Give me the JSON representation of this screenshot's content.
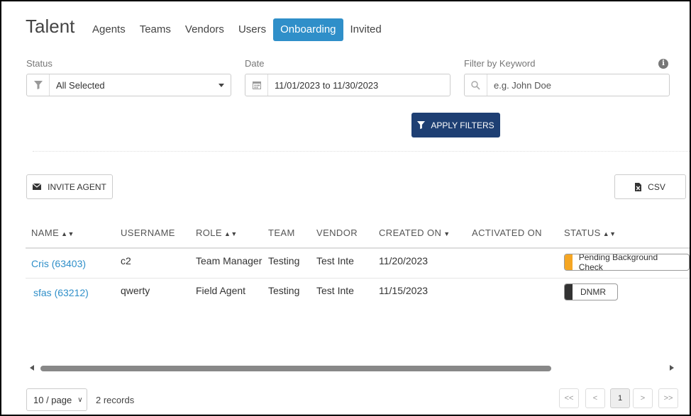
{
  "header": {
    "title": "Talent",
    "tabs": [
      {
        "label": "Agents"
      },
      {
        "label": "Teams"
      },
      {
        "label": "Vendors"
      },
      {
        "label": "Users"
      },
      {
        "label": "Onboarding",
        "active": true
      },
      {
        "label": "Invited"
      }
    ]
  },
  "filters": {
    "status": {
      "label": "Status",
      "value": "All Selected",
      "icon": "filter-icon"
    },
    "date": {
      "label": "Date",
      "value": "11/01/2023 to 11/30/2023",
      "icon": "calendar-icon"
    },
    "keyword": {
      "label": "Filter by Keyword",
      "placeholder": "e.g. John Doe",
      "icon": "search-icon"
    },
    "apply_label": "APPLY FILTERS"
  },
  "actions": {
    "invite_label": "INVITE AGENT",
    "csv_label": "CSV"
  },
  "table": {
    "columns": [
      "NAME",
      "USERNAME",
      "ROLE",
      "TEAM",
      "VENDOR",
      "CREATED ON",
      "ACTIVATED ON",
      "STATUS"
    ],
    "rows": [
      {
        "name": "Cris (63403)",
        "username": "c2",
        "role": "Team Manager",
        "team": "Testing",
        "vendor": "Test Inte",
        "created_on": "11/20/2023",
        "activated_on": "",
        "status": "Pending Background Check",
        "status_color": "#f5a623"
      },
      {
        "name": "sfas (63212)",
        "username": "qwerty",
        "role": "Field Agent",
        "team": "Testing",
        "vendor": "Test Inte",
        "created_on": "11/15/2023",
        "activated_on": "",
        "status": "DNMR",
        "status_color": "#333333"
      }
    ]
  },
  "footer": {
    "page_size": "10 / page",
    "records": "2 records",
    "pagination": {
      "first": "<<",
      "prev": "<",
      "current": "1",
      "next": ">",
      "last": ">>"
    }
  },
  "colors": {
    "accent": "#2f8fc9",
    "primary_button": "#1e3f73"
  }
}
